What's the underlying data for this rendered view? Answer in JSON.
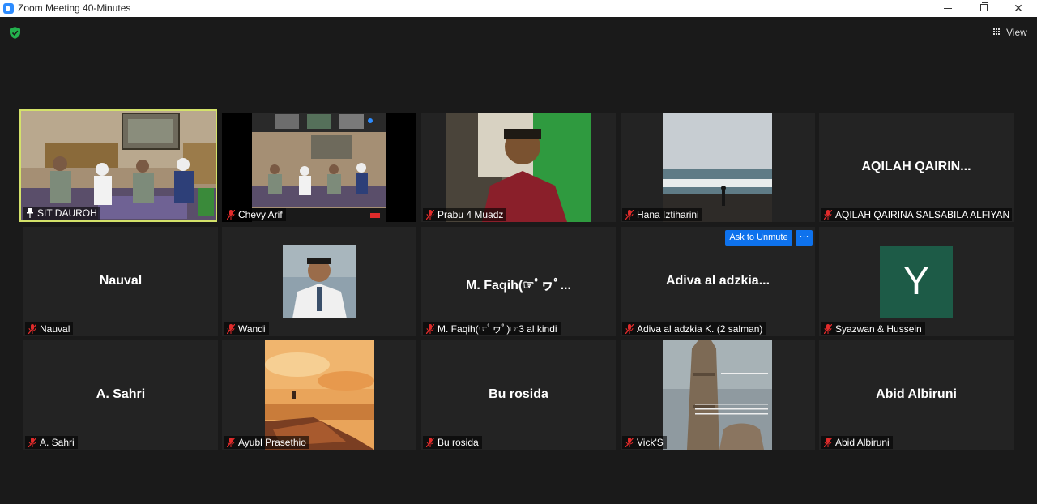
{
  "window": {
    "title": "Zoom Meeting 40-Minutes",
    "close_label": "✕"
  },
  "toolbar": {
    "view_label": "View"
  },
  "actions": {
    "ask_unmute": "Ask to Unmute",
    "more": "···"
  },
  "colors": {
    "active_speaker": "#d4e26a",
    "accent": "#0e72ed",
    "avatar_bg": "#1d5b47",
    "muted_icon": "#e02b2b"
  },
  "tiles": [
    {
      "name": "SIT DAUROH",
      "display_name": "",
      "pinned": true,
      "muted": false,
      "video": true
    },
    {
      "name": "Chevy Arif",
      "display_name": "",
      "muted": true,
      "video": true
    },
    {
      "name": "Prabu 4 Muadz",
      "display_name": "",
      "muted": true,
      "video": true
    },
    {
      "name": "Hana Iztiharini",
      "display_name": "",
      "muted": true,
      "video": true
    },
    {
      "name": "AQILAH QAIRINA SALSABILA ALFIYAN ...",
      "display_name": "AQILAH  QAIRIN...",
      "muted": true,
      "video": false
    },
    {
      "name": "Nauval",
      "display_name": "Nauval",
      "muted": true,
      "video": false
    },
    {
      "name": "Wandi",
      "display_name": "",
      "muted": true,
      "video": true
    },
    {
      "name": "M. Faqih(☞ﾟヮﾟ)☞3 al kindi",
      "display_name": "M. Faqih(☞ﾟヮﾟ...",
      "muted": true,
      "video": false
    },
    {
      "name": "Adiva al adzkia K. (2 salman)",
      "display_name": "Adiva al adzkia...",
      "muted": true,
      "video": false
    },
    {
      "name": "Syazwan & Hussein",
      "display_name": "",
      "avatar_letter": "Y",
      "muted": true,
      "video": false
    },
    {
      "name": "A. Sahri",
      "display_name": "A. Sahri",
      "muted": true,
      "video": false
    },
    {
      "name": "Ayubl Prasethio",
      "display_name": "",
      "muted": true,
      "video": true
    },
    {
      "name": "Bu rosida",
      "display_name": "Bu rosida",
      "muted": true,
      "video": false
    },
    {
      "name": "Vick'S",
      "display_name": "",
      "muted": true,
      "video": true
    },
    {
      "name": "Abid Albiruni",
      "display_name": "Abid Albiruni",
      "muted": true,
      "video": false
    }
  ]
}
